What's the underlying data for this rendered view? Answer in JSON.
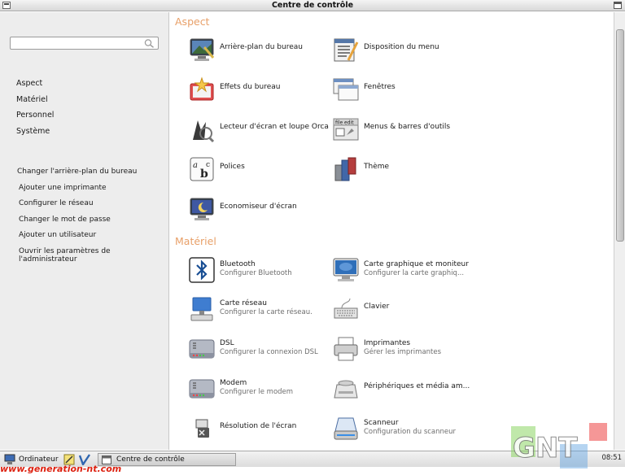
{
  "window": {
    "title": "Centre de contrôle"
  },
  "sidebar": {
    "search_placeholder": "",
    "categories": [
      "Aspect",
      "Matériel",
      "Personnel",
      "Système"
    ],
    "tasks": [
      "Changer l'arrière-plan du bureau",
      "Ajouter une imprimante",
      "Configurer le réseau",
      "Changer le mot de passe",
      "Ajouter un utilisateur",
      "Ouvrir les paramètres de l'administrateur"
    ]
  },
  "sections": {
    "aspect": {
      "title": "Aspect",
      "items": [
        {
          "label": "Arrière-plan du bureau",
          "icon": "desktop-background-icon"
        },
        {
          "label": "Disposition du menu",
          "icon": "menu-layout-icon"
        },
        {
          "label": "Effets du bureau",
          "icon": "desktop-effects-icon"
        },
        {
          "label": "Fenêtres",
          "icon": "windows-icon"
        },
        {
          "label": "Lecteur d'écran et loupe Orca",
          "icon": "orca-icon"
        },
        {
          "label": "Menus & barres d'outils",
          "icon": "toolbars-icon"
        },
        {
          "label": "Polices",
          "icon": "fonts-icon"
        },
        {
          "label": "Thème",
          "icon": "theme-icon"
        },
        {
          "label": "Economiseur d'écran",
          "icon": "screensaver-icon"
        }
      ]
    },
    "materiel": {
      "title": "Matériel",
      "items": [
        {
          "label": "Bluetooth",
          "sub": "Configurer Bluetooth",
          "icon": "bluetooth-icon"
        },
        {
          "label": "Carte graphique et moniteur",
          "sub": "Configurer la carte graphiq...",
          "icon": "monitor-icon"
        },
        {
          "label": "Carte réseau",
          "sub": "Configurer la carte réseau.",
          "icon": "network-card-icon"
        },
        {
          "label": "Clavier",
          "sub": "",
          "icon": "keyboard-icon"
        },
        {
          "label": "DSL",
          "sub": "Configurer la connexion DSL",
          "icon": "dsl-modem-icon"
        },
        {
          "label": "Imprimantes",
          "sub": "Gérer les imprimantes",
          "icon": "printer-icon"
        },
        {
          "label": "Modem",
          "sub": "Configurer le modem",
          "icon": "modem-icon"
        },
        {
          "label": "Périphériques et média am...",
          "sub": "",
          "icon": "removable-media-icon"
        },
        {
          "label": "Résolution de l'écran",
          "sub": "",
          "icon": "screen-resolution-icon"
        },
        {
          "label": "Scanneur",
          "sub": "Configuration du scanneur",
          "icon": "scanner-icon"
        }
      ]
    }
  },
  "taskbar": {
    "start_label": "Ordinateur",
    "task_label": "Centre de contrôle",
    "clock": "08:51"
  },
  "watermark": {
    "site": "www.generation-nt.com",
    "logo": "GNT"
  }
}
